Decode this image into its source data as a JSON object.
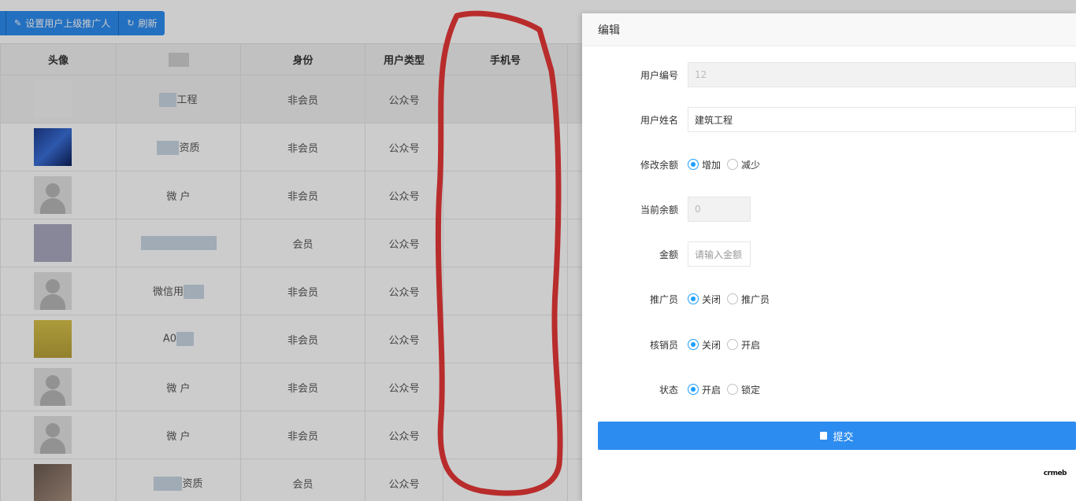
{
  "toolbar": {
    "set_referrer_label": "设置用户上级推广人",
    "refresh_label": "刷新",
    "pencil_icon": "pencil-icon",
    "refresh_icon": "refresh-icon"
  },
  "table": {
    "headers": [
      "头像",
      "",
      "身份",
      "用户类型",
      "手机号"
    ],
    "rows": [
      {
        "name": "工程",
        "identity": "非会员",
        "type": "公众号",
        "phone": ""
      },
      {
        "name": "资质",
        "identity": "非会员",
        "type": "公众号",
        "phone": ""
      },
      {
        "name": "微 户",
        "identity": "非会员",
        "type": "公众号",
        "phone": ""
      },
      {
        "name": "",
        "identity": "会员",
        "type": "公众号",
        "phone": ""
      },
      {
        "name": "微信用",
        "identity": "非会员",
        "type": "公众号",
        "phone": ""
      },
      {
        "name": "A0",
        "identity": "非会员",
        "type": "公众号",
        "phone": ""
      },
      {
        "name": "微 户",
        "identity": "非会员",
        "type": "公众号",
        "phone": ""
      },
      {
        "name": "微 户",
        "identity": "非会员",
        "type": "公众号",
        "phone": ""
      },
      {
        "name": "资质",
        "identity": "会员",
        "type": "公众号",
        "phone": ""
      }
    ]
  },
  "panel": {
    "title": "编辑",
    "user_id_label": "用户编号",
    "user_id_value": "12",
    "user_name_label": "用户姓名",
    "user_name_value": "建筑工程",
    "balance_change_label": "修改余额",
    "balance_increase": "增加",
    "balance_decrease": "减少",
    "current_balance_label": "当前余额",
    "current_balance_value": "0",
    "amount_label": "金额",
    "amount_placeholder": "请输入金额",
    "promoter_label": "推广员",
    "promoter_off": "关闭",
    "promoter_on": "推广员",
    "verifier_label": "核销员",
    "verifier_off": "关闭",
    "verifier_on": "开启",
    "status_label": "状态",
    "status_on": "开启",
    "status_locked": "锁定",
    "submit_label": "提交",
    "watermark": "crmeb"
  },
  "colors": {
    "primary": "#2d8cf0",
    "radio_checked": "#1e9fff",
    "marker": "#e83838"
  }
}
